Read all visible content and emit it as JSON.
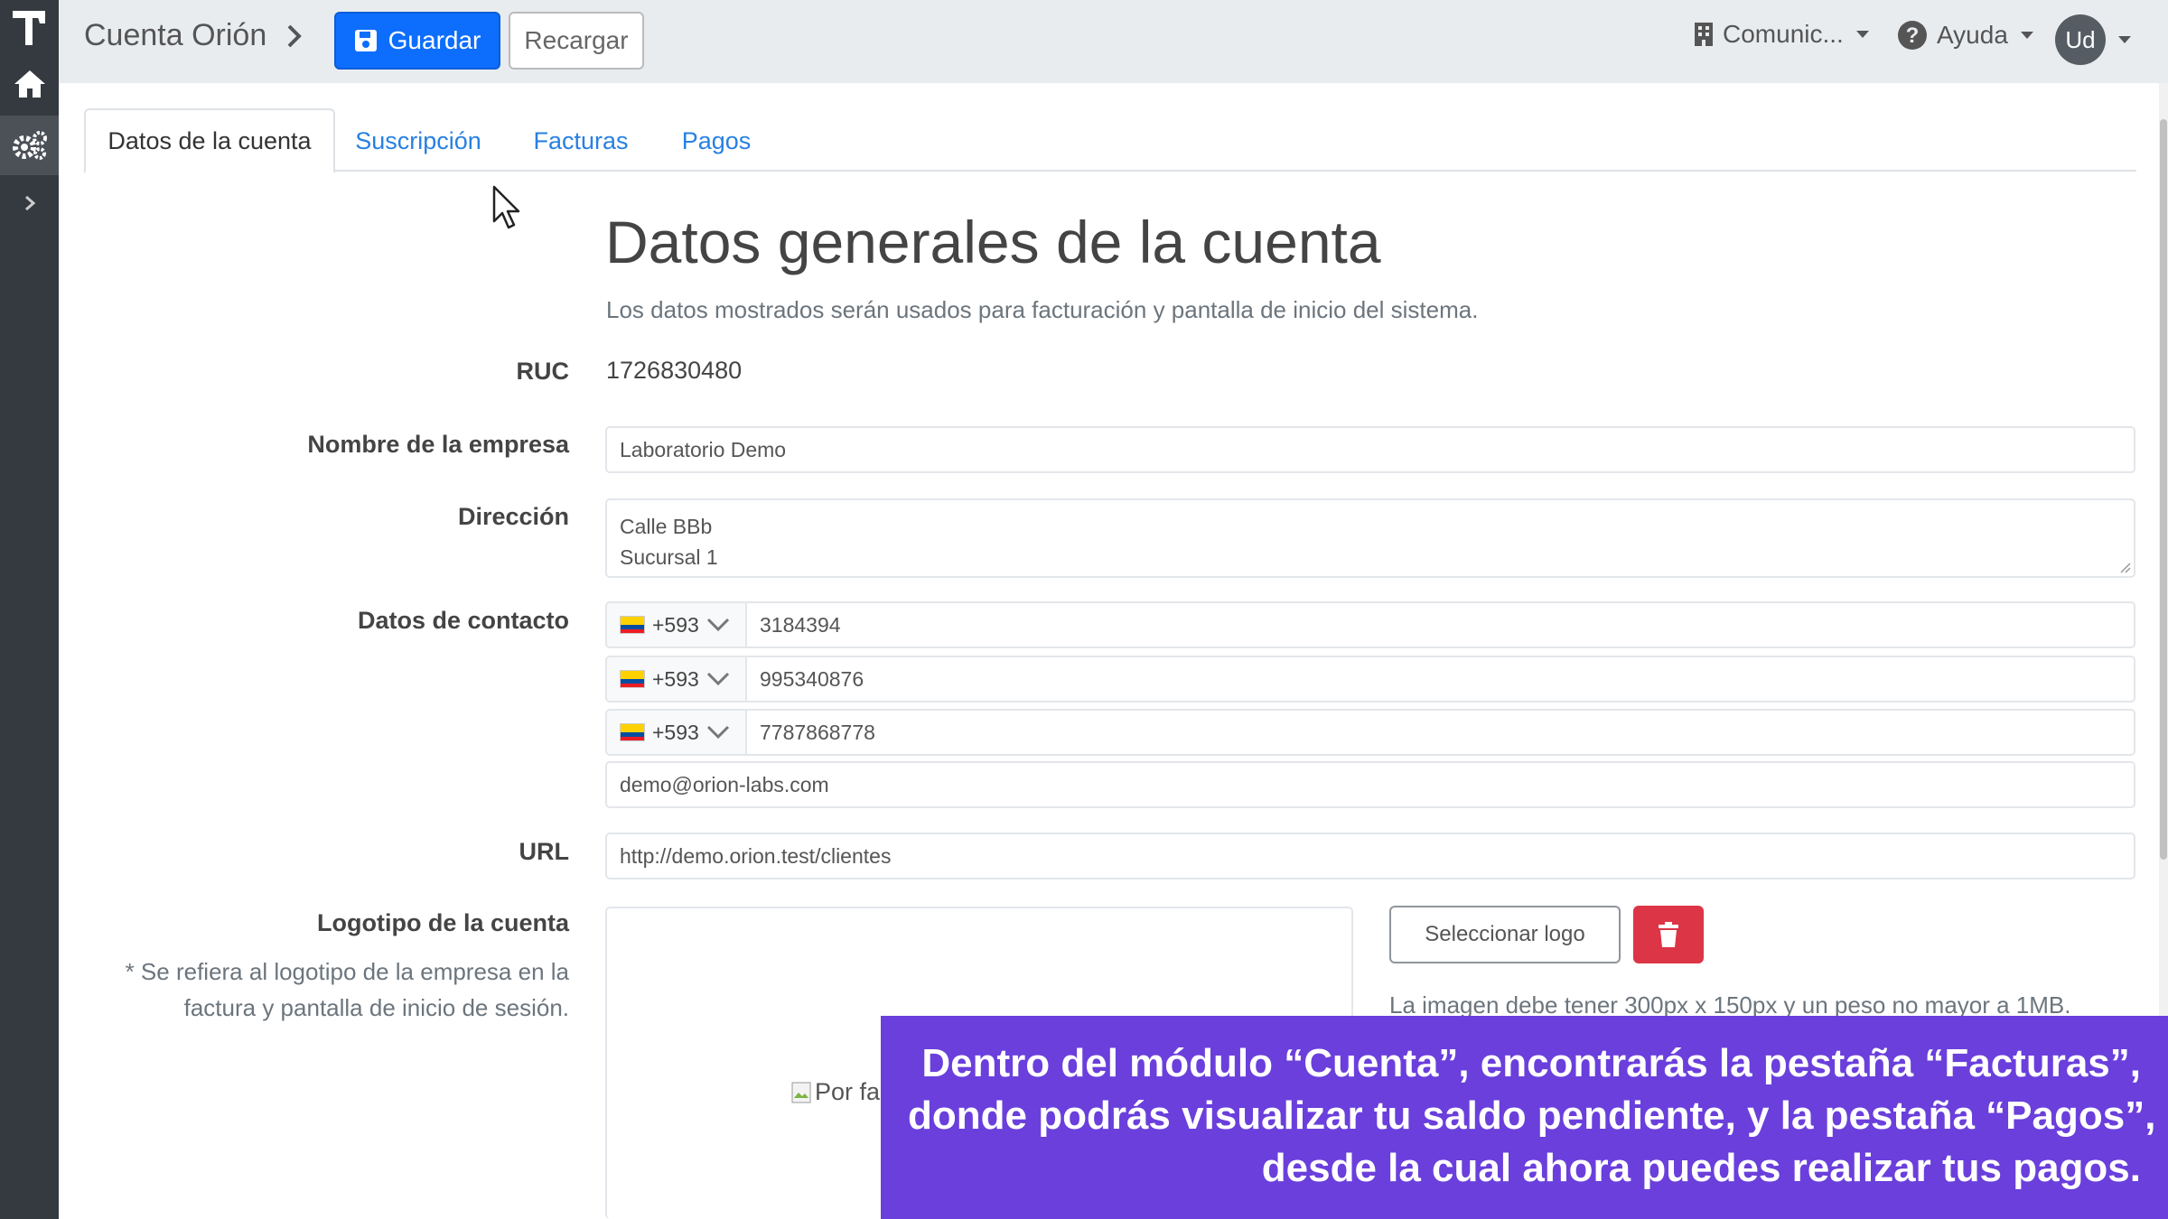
{
  "sidebar": {
    "icons": [
      "logo-t",
      "home-icon",
      "settings-icon",
      "chevron-right-icon"
    ]
  },
  "topbar": {
    "breadcrumb": "Cuenta Orión",
    "save_label": "Guardar",
    "reload_label": "Recargar",
    "company_menu": "Comunic...",
    "help_menu": "Ayuda",
    "user_initials": "Ud"
  },
  "tabs": [
    {
      "label": "Datos de la cuenta",
      "active": true
    },
    {
      "label": "Suscripción",
      "active": false
    },
    {
      "label": "Facturas",
      "active": false
    },
    {
      "label": "Pagos",
      "active": false
    }
  ],
  "section": {
    "title": "Datos generales de la cuenta",
    "subtitle": "Los datos mostrados serán usados para facturación y pantalla de inicio del sistema."
  },
  "form": {
    "ruc_label": "RUC",
    "ruc_value": "1726830480",
    "company_label": "Nombre de la empresa",
    "company_value": "Laboratorio Demo",
    "address_label": "Dirección",
    "address_line1": "Calle BBb",
    "address_line2": "Sucursal 1",
    "contact_label": "Datos de contacto",
    "phones": [
      {
        "code": "+593",
        "number": "3184394"
      },
      {
        "code": "+593",
        "number": "995340876"
      },
      {
        "code": "+593",
        "number": "7787868778"
      }
    ],
    "email_value": "demo@orion-labs.com",
    "url_label": "URL",
    "url_value": "http://demo.orion.test/clientes",
    "logo_label": "Logotipo de la cuenta",
    "logo_note": "* Se refiera al logotipo de la empresa en la factura y pantalla de inicio de sesión.",
    "logo_alt": "Por fa",
    "select_logo_label": "Seleccionar logo",
    "image_hint": "La imagen debe tener 300px x 150px y un peso no mayor a 1MB."
  },
  "caption": {
    "line1": "Dentro del módulo “Cuenta”, encontrarás la pestaña “Facturas”,",
    "line2": "donde podrás visualizar tu saldo pendiente, y la pestaña “Pagos”,",
    "line3": "desde la cual ahora puedes realizar tus pagos."
  },
  "colors": {
    "primary": "#0d6efd",
    "link": "#2780e3",
    "danger": "#dc3545",
    "sidebar": "#343a40",
    "caption_bg": "#6a3fdc"
  }
}
